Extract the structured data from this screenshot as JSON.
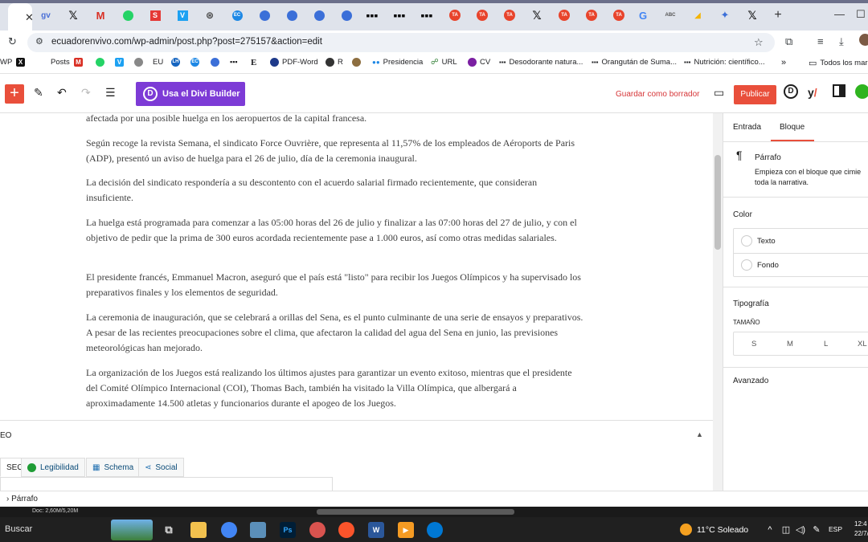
{
  "browser": {
    "url": "ecuadorenvivo.com/wp-admin/post.php?post=275157&action=edit",
    "tab_icons": [
      "chrome-favicon",
      "x-favicon",
      "gmail-favicon",
      "whatsapp-favicon",
      "s-favicon",
      "v-favicon",
      "globe-favicon",
      "ec-favicon",
      "person-favicon",
      "person-favicon",
      "person-favicon",
      "person-favicon",
      "dots-favicon",
      "dots-favicon",
      "dots-favicon",
      "ta-favicon",
      "ta-favicon",
      "ta-favicon",
      "x-favicon",
      "ta-favicon",
      "ta-favicon",
      "ta-favicon",
      "google-favicon",
      "abc-favicon",
      "maps-favicon",
      "puzzle-favicon",
      "x-favicon"
    ],
    "new_tab_label": "+",
    "bookmarks": [
      {
        "label": "WP"
      },
      {
        "label": ""
      },
      {
        "label": "Posts"
      },
      {
        "label": ""
      },
      {
        "label": ""
      },
      {
        "label": ""
      },
      {
        "label": "EU"
      },
      {
        "label": "LH"
      },
      {
        "label": "EC"
      },
      {
        "label": ""
      },
      {
        "label": "E"
      },
      {
        "label": "PDF-Word"
      },
      {
        "label": "R"
      },
      {
        "label": ""
      },
      {
        "label": "Presidencia"
      },
      {
        "label": "URL"
      },
      {
        "label": "CV"
      },
      {
        "label": "Desodorante natura..."
      },
      {
        "label": "Orangután de Suma..."
      },
      {
        "label": "Nutrición: científico..."
      },
      {
        "label": "Todos los mar"
      }
    ]
  },
  "editor": {
    "add_label": "+",
    "divi_logo": "D",
    "divi_label": "Usa el Divi Builder",
    "draft_label": "Guardar como borrador",
    "publish_label": "Publicar",
    "paragraphs": [
      "afectada por una posible huelga en los aeropuertos de la capital francesa.",
      "Según recoge la revista Semana, el sindicato Force Ouvrière, que representa al 11,57% de los empleados de Aéroports de Paris (ADP), presentó un aviso de huelga para el 26 de julio, día de la ceremonia inaugural.",
      "La decisión del sindicato respondería a su descontento con el acuerdo salarial firmado recientemente, que consideran insuficiente.",
      "La huelga está programada para comenzar a las 05:00 horas del 26 de julio y finalizar a las 07:00 horas del 27 de julio, y con el objetivo de pedir que la prima de 300 euros acordada recientemente pase a 1.000 euros, así como otras medidas salariales.",
      "El presidente francés, Emmanuel Macron, aseguró que el país está \"listo\" para recibir los Juegos Olímpicos y ha supervisado los preparativos finales y los elementos de seguridad.",
      "La ceremonia de inauguración, que se celebrará a orillas del Sena, es el punto culminante de una serie de ensayos y preparativos. A pesar de las recientes preocupaciones sobre el clima, que afectaron la calidad del agua del Sena en junio, las previsiones meteorológicas han mejorado.",
      "La organización de los Juegos está realizando los últimos ajustes para garantizar un evento exitoso, mientras que el presidente del Comité Olímpico Internacional (COI), Thomas Bach, también ha visitado la Villa Olímpica, que albergará a aproximadamente 14.500 atletas y funcionarios durante el apogeo de los Juegos."
    ],
    "breadcrumb": "Párrafo"
  },
  "seo": {
    "title": "EO",
    "tabs": [
      {
        "label": "SEO"
      },
      {
        "label": "Legibilidad"
      },
      {
        "label": "Schema"
      },
      {
        "label": "Social"
      }
    ]
  },
  "sidebar": {
    "tab_entrada": "Entrada",
    "tab_bloque": "Bloque",
    "block_name": "Párrafo",
    "block_desc": "Empieza con el bloque que cimie toda la narrativa.",
    "color_heading": "Color",
    "color_text": "Texto",
    "color_bg": "Fondo",
    "typography_heading": "Tipografía",
    "size_label": "TAMAÑO",
    "sizes": [
      "S",
      "M",
      "L",
      "XL"
    ],
    "advanced_heading": "Avanzado"
  },
  "status": {
    "doc_info": "Doc: 2,60M/5,20M"
  },
  "taskbar": {
    "search_label": "Buscar",
    "weather": "11°C  Soleado",
    "lang": "ESP",
    "time": "12:4",
    "date": "22/7/2"
  }
}
